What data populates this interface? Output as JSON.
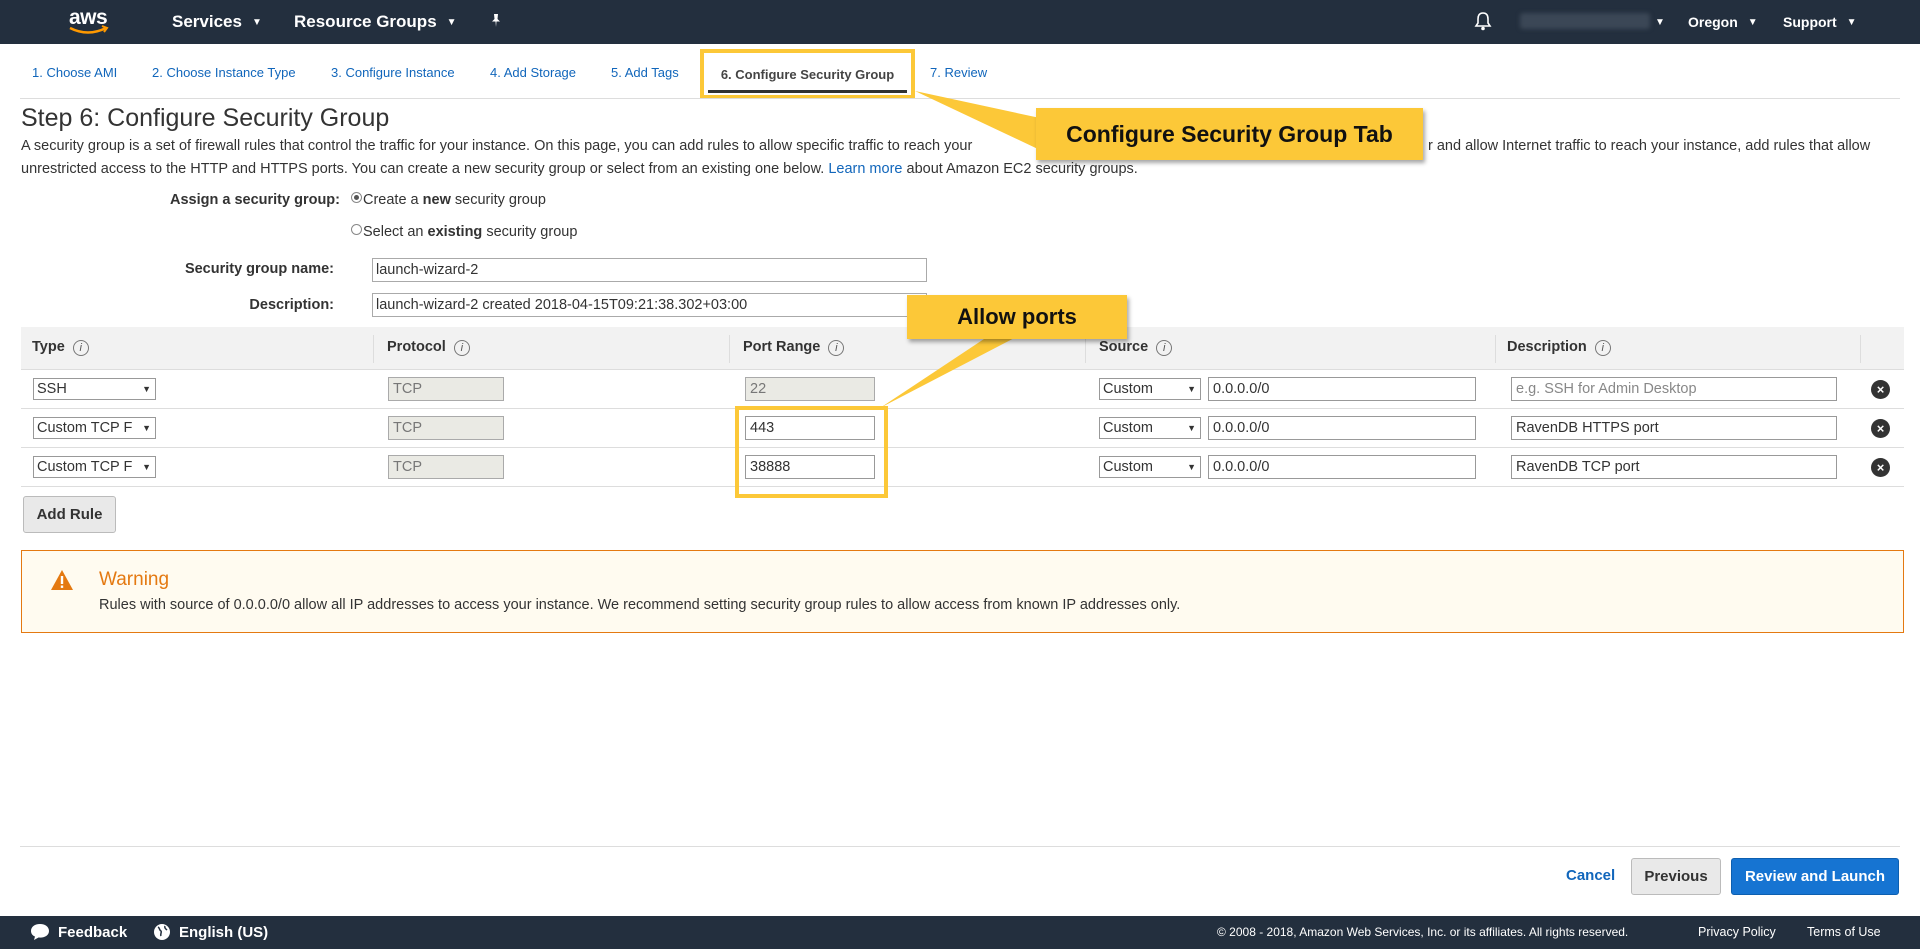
{
  "topnav": {
    "logo": "aws",
    "services": "Services",
    "resource_groups": "Resource Groups",
    "region": "Oregon",
    "support": "Support"
  },
  "tabs": [
    {
      "label": "1. Choose AMI"
    },
    {
      "label": "2. Choose Instance Type"
    },
    {
      "label": "3. Configure Instance"
    },
    {
      "label": "4. Add Storage"
    },
    {
      "label": "5. Add Tags"
    },
    {
      "label": "6. Configure Security Group"
    },
    {
      "label": "7. Review"
    }
  ],
  "page": {
    "title": "Step 6: Configure Security Group",
    "desc_1": "A security group is a set of firewall rules that control the traffic for your instance. On this page, you can add rules to allow specific traffic to reach your",
    "desc_1b": "r and allow Internet traffic to reach your instance, add rules that allow",
    "desc_2": "unrestricted access to the HTTP and HTTPS ports. You can create a new security group or select from an existing one below.",
    "learn_more": "Learn more",
    "desc_3": "about Amazon EC2 security groups."
  },
  "form": {
    "assign_label": "Assign a security group:",
    "radio_new_pre": "Create a ",
    "radio_new_bold": "new",
    "radio_new_post": " security group",
    "radio_existing_pre": "Select an ",
    "radio_existing_bold": "existing",
    "radio_existing_post": " security group",
    "name_label": "Security group name:",
    "name_value": "launch-wizard-2",
    "desc_label": "Description:",
    "desc_value": "launch-wizard-2 created 2018-04-15T09:21:38.302+03:00"
  },
  "table": {
    "headers": {
      "type": "Type",
      "protocol": "Protocol",
      "port_range": "Port Range",
      "source": "Source",
      "description": "Description"
    },
    "info_glyph": "i",
    "rows": [
      {
        "type": "SSH",
        "protocol": "TCP",
        "port": "22",
        "source": "Custom",
        "cidr": "0.0.0.0/0",
        "description": "",
        "desc_placeholder": "e.g. SSH for Admin Desktop"
      },
      {
        "type": "Custom TCP F",
        "protocol": "TCP",
        "port": "443",
        "source": "Custom",
        "cidr": "0.0.0.0/0",
        "description": "RavenDB HTTPS port"
      },
      {
        "type": "Custom TCP F",
        "protocol": "TCP",
        "port": "38888",
        "source": "Custom",
        "cidr": "0.0.0.0/0",
        "description": "RavenDB TCP port"
      }
    ],
    "add_rule": "Add Rule"
  },
  "warning": {
    "title": "Warning",
    "message": "Rules with source of 0.0.0.0/0 allow all IP addresses to access your instance. We recommend setting security group rules to allow access from known IP addresses only."
  },
  "actions": {
    "cancel": "Cancel",
    "previous": "Previous",
    "review": "Review and Launch"
  },
  "footer": {
    "feedback": "Feedback",
    "language": "English (US)",
    "copyright": "© 2008 - 2018, Amazon Web Services, Inc. or its affiliates. All rights reserved.",
    "privacy": "Privacy Policy",
    "terms": "Terms of Use"
  },
  "callouts": {
    "tab": "Configure Security Group Tab",
    "ports": "Allow ports"
  },
  "colors": {
    "nav_bg": "#232f3e",
    "link": "#1166bb",
    "highlight": "#fcc838",
    "warning": "#e47911",
    "primary_button": "#1674d2"
  }
}
